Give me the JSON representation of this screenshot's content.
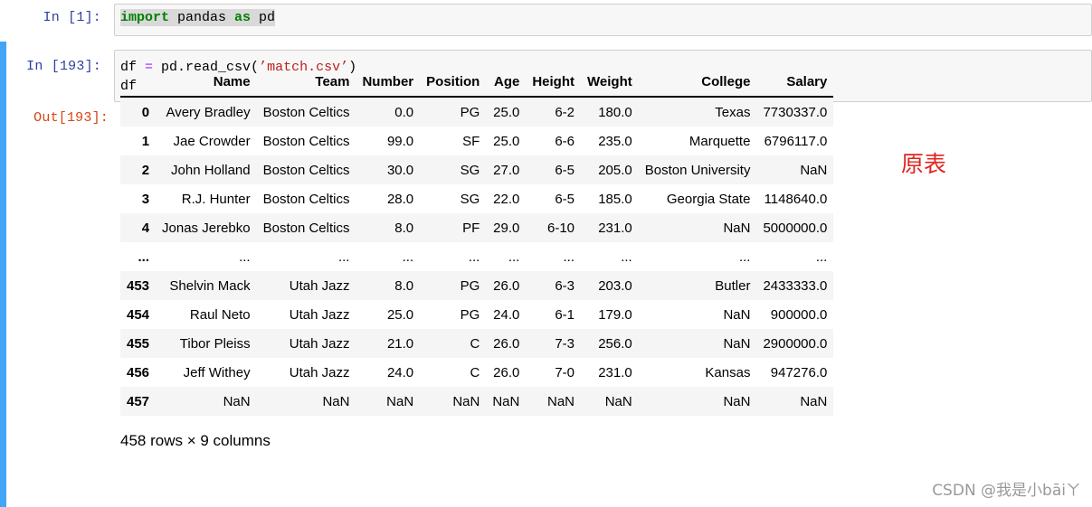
{
  "cell1": {
    "prompt": "In  [1]:",
    "code": {
      "kw1": "import",
      "mid": " pandas ",
      "kw2": "as",
      "end": " pd"
    }
  },
  "cell2": {
    "prompt_in": "In  [193]:",
    "line1": {
      "a": "df ",
      "eq": "=",
      "b": " pd.read_csv(",
      "s": "’match.csv’",
      "c": ")"
    },
    "line2": "df",
    "prompt_out": "Out[193]:"
  },
  "dataframe": {
    "columns": [
      "Name",
      "Team",
      "Number",
      "Position",
      "Age",
      "Height",
      "Weight",
      "College",
      "Salary"
    ],
    "rows": [
      {
        "index": "0",
        "cells": [
          "Avery Bradley",
          "Boston Celtics",
          "0.0",
          "PG",
          "25.0",
          "6-2",
          "180.0",
          "Texas",
          "7730337.0"
        ]
      },
      {
        "index": "1",
        "cells": [
          "Jae Crowder",
          "Boston Celtics",
          "99.0",
          "SF",
          "25.0",
          "6-6",
          "235.0",
          "Marquette",
          "6796117.0"
        ]
      },
      {
        "index": "2",
        "cells": [
          "John Holland",
          "Boston Celtics",
          "30.0",
          "SG",
          "27.0",
          "6-5",
          "205.0",
          "Boston University",
          "NaN"
        ]
      },
      {
        "index": "3",
        "cells": [
          "R.J. Hunter",
          "Boston Celtics",
          "28.0",
          "SG",
          "22.0",
          "6-5",
          "185.0",
          "Georgia State",
          "1148640.0"
        ]
      },
      {
        "index": "4",
        "cells": [
          "Jonas Jerebko",
          "Boston Celtics",
          "8.0",
          "PF",
          "29.0",
          "6-10",
          "231.0",
          "NaN",
          "5000000.0"
        ]
      },
      {
        "index": "...",
        "cells": [
          "...",
          "...",
          "...",
          "...",
          "...",
          "...",
          "...",
          "...",
          "..."
        ]
      },
      {
        "index": "453",
        "cells": [
          "Shelvin Mack",
          "Utah Jazz",
          "8.0",
          "PG",
          "26.0",
          "6-3",
          "203.0",
          "Butler",
          "2433333.0"
        ]
      },
      {
        "index": "454",
        "cells": [
          "Raul Neto",
          "Utah Jazz",
          "25.0",
          "PG",
          "24.0",
          "6-1",
          "179.0",
          "NaN",
          "900000.0"
        ]
      },
      {
        "index": "455",
        "cells": [
          "Tibor Pleiss",
          "Utah Jazz",
          "21.0",
          "C",
          "26.0",
          "7-3",
          "256.0",
          "NaN",
          "2900000.0"
        ]
      },
      {
        "index": "456",
        "cells": [
          "Jeff Withey",
          "Utah Jazz",
          "24.0",
          "C",
          "26.0",
          "7-0",
          "231.0",
          "Kansas",
          "947276.0"
        ]
      },
      {
        "index": "457",
        "cells": [
          "NaN",
          "NaN",
          "NaN",
          "NaN",
          "NaN",
          "NaN",
          "NaN",
          "NaN",
          "NaN"
        ]
      }
    ],
    "shape": "458 rows × 9 columns"
  },
  "annotation": "原表",
  "watermark": "CSDN @我是小bāiㄚ",
  "colors": {
    "cell_selected_bar": "#42a5f5",
    "in_prompt": "#303f9f",
    "out_prompt": "#d84315",
    "annotation": "#e0241f"
  }
}
